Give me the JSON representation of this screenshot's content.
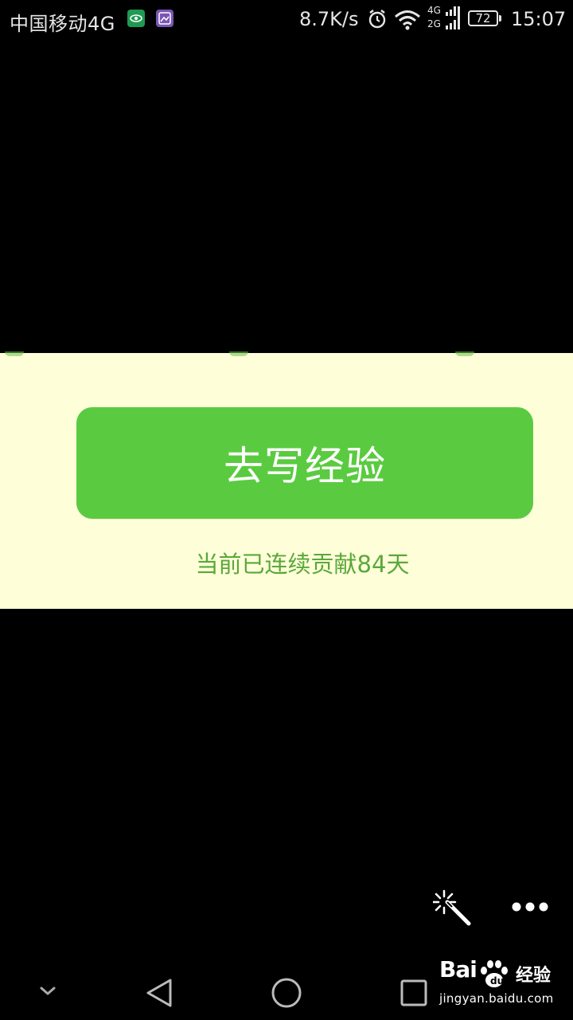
{
  "status_bar": {
    "carrier": "中国移动4G",
    "net_speed": "8.7K/s",
    "network_labels": [
      "4G",
      "2G"
    ],
    "battery": "72",
    "time": "15:07",
    "app_icons": [
      "eye-app-icon",
      "gallery-app-icon"
    ]
  },
  "content": {
    "button_label": "去写经验",
    "streak_text": "当前已连续贡献84天"
  },
  "overlay": {
    "magic_icon": "magic-wand-icon",
    "more_icon": "more-dots-icon"
  },
  "nav": {
    "icons": [
      "chevron-down-icon",
      "back-triangle-icon",
      "home-circle-icon",
      "recent-square-icon"
    ]
  },
  "watermark": {
    "logo_text": "Bai",
    "logo_suffix": "经验",
    "url": "jingyan.baidu.com"
  },
  "colors": {
    "background": "#000000",
    "panel": "#fefed9",
    "button": "#5acb40",
    "streak_text": "#5aa83a",
    "status_text": "#e6e6e6"
  }
}
